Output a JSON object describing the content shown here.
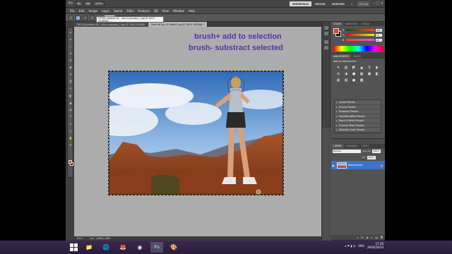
{
  "titlebar": {
    "logo": "Ps",
    "zoom": "100%",
    "workspaces": [
      "ESSENTIALS",
      "DESIGN",
      "PAINTING",
      "»"
    ],
    "cs_live": "CS Live",
    "controls": [
      "–",
      "□",
      "×"
    ]
  },
  "menu": [
    "File",
    "Edit",
    "Image",
    "Layer",
    "Select",
    "Filter",
    "Analysis",
    "3D",
    "View",
    "Window",
    "Help"
  ],
  "options": {
    "size_label": "Size:",
    "size_value": "30 px",
    "buttons": [
      "Refine Edge..."
    ]
  },
  "tooltip": "50796_gradkon-01 - foto-s-paradas_1.jpg @ 100% (RGB/8#)\n...",
  "tabs": [
    "58716_gradkon-01 - foto-s-paradas_1.jpg @ 100% (RGB/8",
    "5640 98 Spr-01 New01.jpg @ 100% (RGB/8) *"
  ],
  "annotations": {
    "line1": "brush+ add to selection",
    "line2": "brush- substract selected"
  },
  "status": {
    "zoom": "100%",
    "doc": "Doc: 1,88M/1,88M"
  },
  "color_panel": {
    "tabs": [
      "COLOR",
      "SWATCHES",
      "STYLES"
    ],
    "channels": [
      {
        "name": "R",
        "value": "226"
      },
      {
        "name": "G",
        "value": "79"
      },
      {
        "name": "B",
        "value": "29"
      }
    ],
    "foreground": "#d04a1e",
    "background": "#111111"
  },
  "adjustments_panel": {
    "tabs": [
      "ADJUSTMENTS",
      "MASKS"
    ],
    "title": "Add an adjustment",
    "icons": [
      "☀",
      "▥",
      "◩",
      "▲",
      "∇",
      "◐",
      "⚖",
      "◑",
      "●",
      "▦",
      "▣",
      "◧",
      "▧",
      "▨",
      "◼",
      "▩"
    ],
    "presets": [
      "Levels Presets",
      "Curves Presets",
      "Exposure Presets",
      "Hue/Saturation Presets",
      "Black & White Presets",
      "Channel Mixer Presets",
      "Selective Color Presets"
    ]
  },
  "layers_panel": {
    "tabs": [
      "LAYERS",
      "CHANNELS",
      "PATHS"
    ],
    "blend_mode": "Normal",
    "opacity_label": "Opacity:",
    "opacity_value": "100%",
    "fill_label": "Fill:",
    "fill_value": "100%",
    "layers": [
      {
        "name": "Background",
        "locked": true
      }
    ],
    "footer_icons": [
      "∞",
      "fx",
      "◑",
      "▭",
      "▤",
      "🗑"
    ]
  },
  "tools": [
    "▸",
    "▭",
    "◌",
    "✶",
    "⌗",
    "✚",
    "✎",
    "⎘",
    "☼",
    "◐",
    "▲",
    "◍",
    "T",
    "↖",
    "▢",
    "✋",
    "⚲"
  ],
  "taskbar": {
    "apps": [
      "📁",
      "🌐",
      "🦊",
      "◉",
      "Ps",
      "🎨"
    ],
    "tray_lang": "ENG",
    "time": "17:36",
    "date": "26/02/2014"
  }
}
